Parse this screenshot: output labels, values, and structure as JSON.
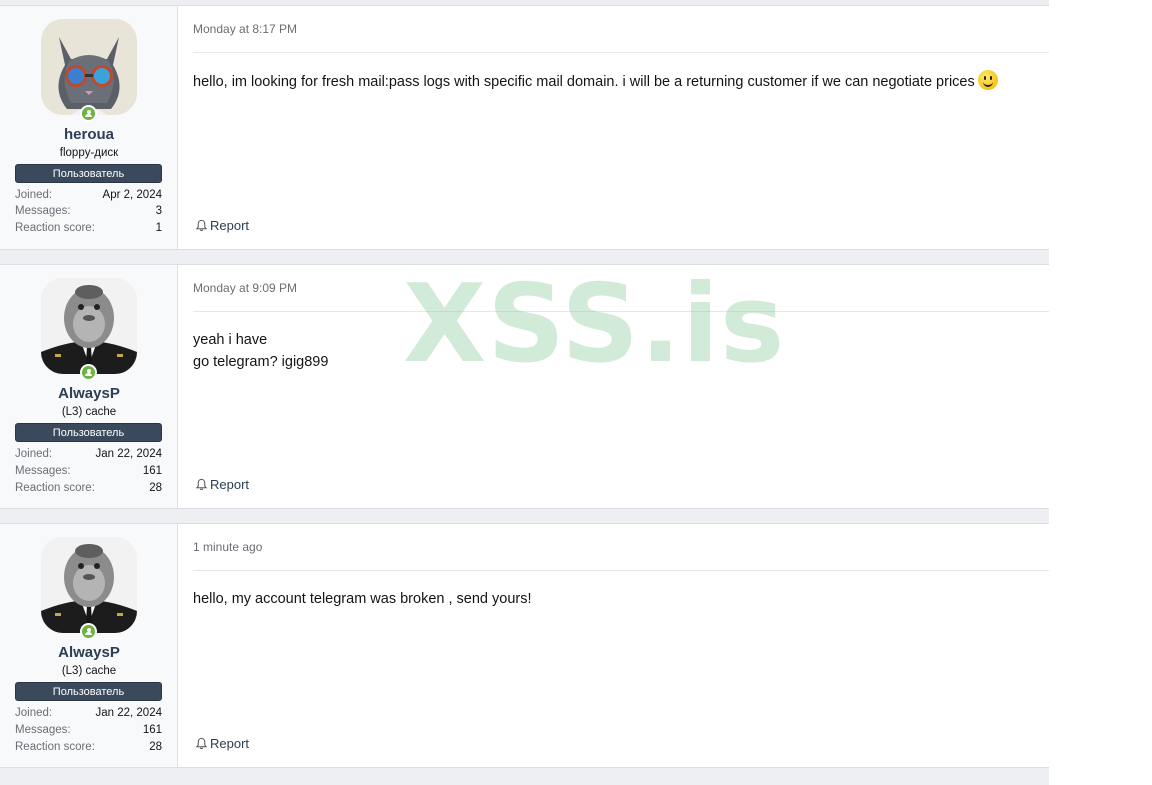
{
  "posts": [
    {
      "user": {
        "name": "heroua",
        "title": "floppy-диск",
        "banner": "Пользователь",
        "joined_label": "Joined:",
        "joined": "Apr 2, 2024",
        "messages_label": "Messages:",
        "messages": "3",
        "reaction_label": "Reaction score:",
        "reaction": "1",
        "avatar_icon": "cat-with-glasses-avatar"
      },
      "date": "Monday at 8:17 PM",
      "body_lines": [
        "hello, im looking for fresh mail:pass logs with specific mail domain. i will be a returning customer if we can negotiate prices"
      ],
      "has_smiley": true,
      "report_label": "Report"
    },
    {
      "user": {
        "name": "AlwaysP",
        "title": "(L3) cache",
        "banner": "Пользователь",
        "joined_label": "Joined:",
        "joined": "Jan 22, 2024",
        "messages_label": "Messages:",
        "messages": "161",
        "reaction_label": "Reaction score:",
        "reaction": "28",
        "avatar_icon": "gorilla-in-suit-avatar"
      },
      "date": "Monday at 9:09 PM",
      "body_lines": [
        "yeah i have",
        "go telegram? igig899"
      ],
      "has_smiley": false,
      "report_label": "Report"
    },
    {
      "user": {
        "name": "AlwaysP",
        "title": "(L3) cache",
        "banner": "Пользователь",
        "joined_label": "Joined:",
        "joined": "Jan 22, 2024",
        "messages_label": "Messages:",
        "messages": "161",
        "reaction_label": "Reaction score:",
        "reaction": "28",
        "avatar_icon": "gorilla-in-suit-avatar"
      },
      "date": "1 minute ago",
      "body_lines": [
        "hello, my account telegram was broken , send yours!"
      ],
      "has_smiley": false,
      "report_label": "Report"
    }
  ],
  "watermark": "XSS.is",
  "colors": {
    "banner_bg": "#3a4a5c",
    "username": "#2b3e53",
    "online": "#6cb33f"
  }
}
